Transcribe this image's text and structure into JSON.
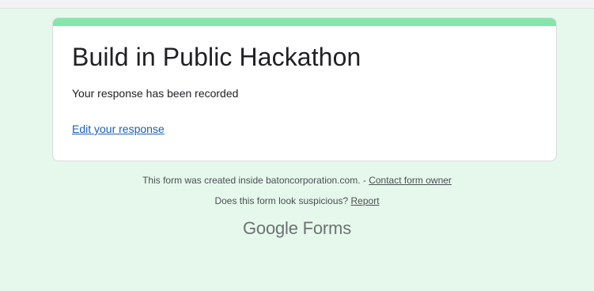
{
  "form": {
    "title": "Build in Public Hackathon",
    "confirmation": "Your response has been recorded",
    "edit_link": "Edit your response",
    "accent_color": "#86e6a9",
    "background_color": "#e6f8ec"
  },
  "footer": {
    "created_text": "This form was created inside batoncorporation.com. - ",
    "contact_link": "Contact form owner",
    "suspicious_text": "Does this form look suspicious? ",
    "report_link": "Report",
    "logo_brand": "Google",
    "logo_product": " Forms"
  }
}
